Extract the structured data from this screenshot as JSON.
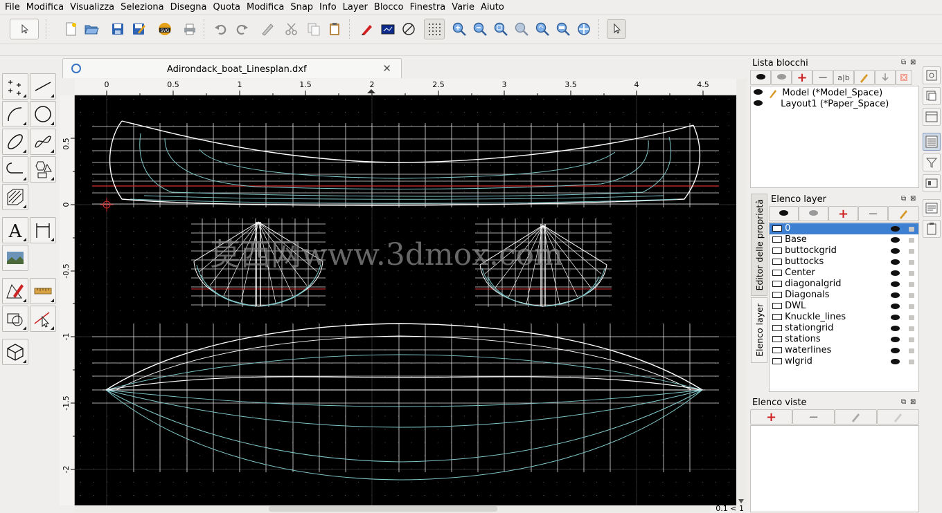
{
  "menu": [
    "File",
    "Modifica",
    "Visualizza",
    "Seleziona",
    "Disegna",
    "Quota",
    "Modifica",
    "Snap",
    "Info",
    "Layer",
    "Blocco",
    "Finestra",
    "Varie",
    "Aiuto"
  ],
  "document": {
    "tab_title": "Adirondack_boat_Linesplan.dxf",
    "close_glyph": "✕"
  },
  "ruler_x": [
    "0",
    "0.5",
    "1",
    "1.5",
    "2",
    "2.5",
    "3",
    "3.5",
    "4",
    "4.5"
  ],
  "ruler_y": [
    "0.5",
    "0",
    "-0.5",
    "-1",
    "-1.5",
    "-2"
  ],
  "watermark": "莫西网www.3dmox.com",
  "zoom_status": "0.1 < 1",
  "blocks_panel": {
    "title": "Lista blocchi",
    "items": [
      "Model (*Model_Space)",
      "Layout1 (*Paper_Space)"
    ]
  },
  "layers_panel": {
    "title": "Elenco layer",
    "selected": "0",
    "items": [
      "0",
      "Base",
      "buttockgrid",
      "buttocks",
      "Center",
      "diagonalgrid",
      "Diagonals",
      "DWL",
      "Knuckle_lines",
      "stationgrid",
      "stations",
      "waterlines",
      "wlgrid"
    ]
  },
  "views_panel": {
    "title": "Elenco viste"
  },
  "side_tabs": [
    "Editor delle proprietà",
    "Elenco layer"
  ],
  "colors": {
    "accent_selection": "#3d7fd0",
    "canvas": "#000000",
    "hull_line": "#ffffff",
    "station_line": "#7fc6c9",
    "dwl_line": "#d83030"
  }
}
